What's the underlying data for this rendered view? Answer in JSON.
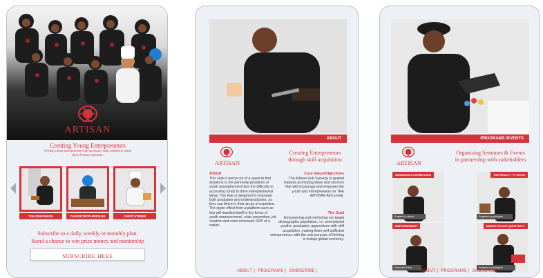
{
  "screen1": {
    "logo_text": "ARTISAN",
    "headline": "Creating Young Entrepreneurs",
    "subline": "Giving young entrepreneurs the necessary help needed to setup their Artistry business.",
    "categories": [
      {
        "label": "TAILOR/FASHION"
      },
      {
        "label": "CARPENTRY/FURNITURE"
      },
      {
        "label": "CHEF/CATERER"
      }
    ],
    "subscribe_text_1": "Subscribe to a daily, weekly or monthly plan.",
    "subscribe_text_2": "Stand a chance to win prize money and mentorship",
    "subscribe_button": "SUBSCRIBE HERE"
  },
  "screen2": {
    "bar_label": "ABOUT",
    "logo_text": "ARTISAN",
    "headline_1": "Creating Entrepreneurs",
    "headline_2": "through skill acquisition",
    "about_title": "About",
    "about_text": "This Hub is borne out of a quest to find solutions to the perennial problems of youth unemployment and the difficulty in accessing funds to drive entrepreneurial ideas. The Hub is designed to empower both graduates and undergraduates, so they can thrive in their areas of expertise. The ripple effect from a platform such as this will manifest itself in the forms of youth empowerment, crisis prevention, job creation and even increased GDP of a nation.",
    "core_title": "Core Value/Objectives",
    "core_text": "The Artisan Hub Synergy is geared towards promoting ideas and services that will encourage and empower the youth and entrepreneurs on THE ARTISAN Africa Hub.",
    "goal_title": "The Goal",
    "goal_text": "Empowering and mentoring our target demographic population, i.e. unemployed youths, graduates, apprentices with skill acquisition, making them self-sufficient entrepreneurs with the sole purpose of thriving in todays global economy.",
    "nav": [
      "ABOUT",
      "PROGRAMS",
      "SUBSCRIBE"
    ]
  },
  "screen3": {
    "bar_label": "PROGRAMS /EVENTS",
    "logo_text": "ARTISAN",
    "headline_1": "Organizing Seminars & Events",
    "headline_2": "in partnership with stakeholders",
    "events": [
      {
        "tag": "SEMINARS & EXHIBITIONS",
        "cta": "Register to attend"
      },
      {
        "tag": "THE REALITY TV SHOW",
        "cta": "Register to participate"
      },
      {
        "tag": "EMPOWERMENT",
        "cta": "Subscribe Here"
      },
      {
        "tag": "MARKETPLACE QUARTERLY",
        "cta": "Register to participate"
      }
    ],
    "nav": [
      "ABOUT",
      "PROGRAMS",
      "SUBSCRIBE"
    ]
  },
  "colors": {
    "accent": "#d6323a",
    "panel_bg": "#edf1f6",
    "border": "#b9c0c8"
  },
  "icons": {
    "left_arrow": "chevron-left-icon",
    "right_arrow": "chevron-right-icon"
  }
}
